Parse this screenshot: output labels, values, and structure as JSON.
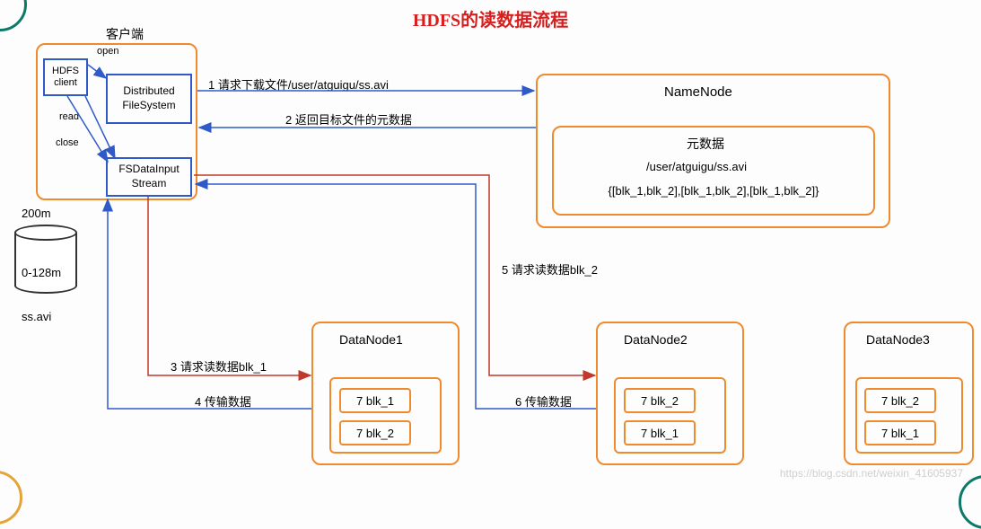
{
  "title": "HDFS的读数据流程",
  "client_label": "客户端",
  "hdfs_client": "HDFS\nclient",
  "distributed_fs": "Distributed\nFileSystem",
  "fsdata_input": "FSDataInput\nStream",
  "open_label": "open",
  "read_label": "read",
  "close_label": "close",
  "storage_top": "200m",
  "storage_range": "0-128m",
  "storage_file": "ss.avi",
  "namenode": {
    "title": "NameNode",
    "metadata_title": "元数据",
    "path": "/user/atguigu/ss.avi",
    "blocks": "{[blk_1,blk_2],[blk_1,blk_2],[blk_1,blk_2]}"
  },
  "datanodes": [
    {
      "name": "DataNode1",
      "blocks": [
        "7 blk_1",
        "7 blk_2"
      ]
    },
    {
      "name": "DataNode2",
      "blocks": [
        "7 blk_2",
        "7 blk_1"
      ]
    },
    {
      "name": "DataNode3",
      "blocks": [
        "7 blk_2",
        "7 blk_1"
      ]
    }
  ],
  "steps": {
    "s1": "1 请求下载文件/user/atguigu/ss.avi",
    "s2": "2 返回目标文件的元数据",
    "s3": "3 请求读数据blk_1",
    "s4": "4 传输数据",
    "s5": "5 请求读数据blk_2",
    "s6": "6 传输数据"
  },
  "watermark": "https://blog.csdn.net/weixin_41605937"
}
